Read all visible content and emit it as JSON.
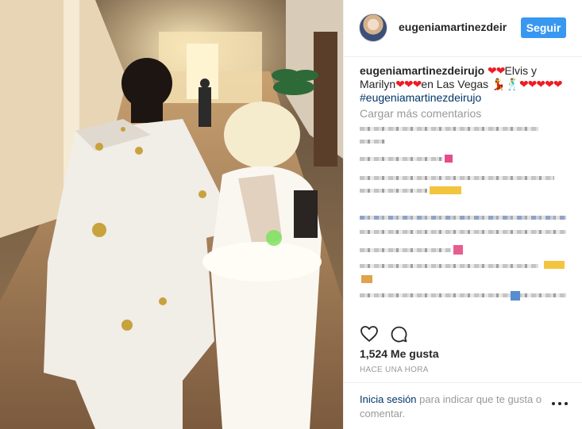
{
  "header": {
    "username": "eugeniamartinezdeirujo",
    "follow_label": "Seguir"
  },
  "caption": {
    "username": "eugeniamartinezdeirujo",
    "hearts_1": "❤❤",
    "text_1": "Elvis y",
    "text_2": "Marilyn",
    "hearts_2": "❤❤❤",
    "text_3": "en Las Vegas",
    "dance_emoji": "💃🕺",
    "hearts_3": "❤❤❤❤❤",
    "hashtag": "#eugeniamartinezdeirujo"
  },
  "load_more_label": "Cargar más comentarios",
  "likes_label": "1,524 Me gusta",
  "time_label": "HACE UNA HORA",
  "footer": {
    "login_link": "Inicia sesión",
    "login_rest": " para indicar que te gusta o comentar."
  },
  "colors": {
    "accent": "#3897f0",
    "link": "#003569",
    "muted": "#999999",
    "heart": "#ed1c24"
  },
  "icons": [
    "heart-icon",
    "comment-icon",
    "more-options-icon"
  ]
}
